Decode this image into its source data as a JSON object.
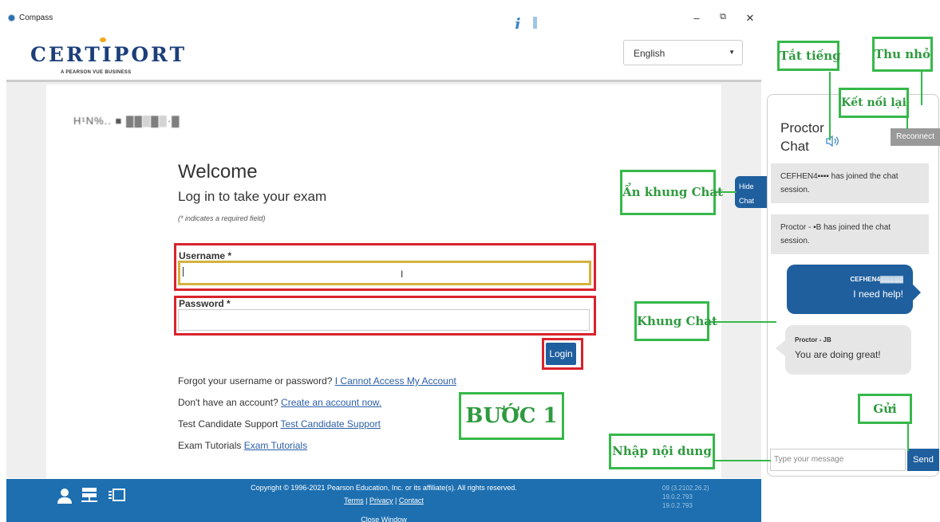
{
  "window": {
    "title": "Compass",
    "info_glyph": "i",
    "min": "–",
    "restore": "⧉",
    "close": "✕"
  },
  "brand": {
    "logo": "CERTIPORT",
    "logo_sub": "A PEARSON VUE BUSINESS",
    "accent": "#1c3f7a"
  },
  "language": {
    "selected": "English"
  },
  "login": {
    "candidate_id": "H¹N%.. ■ ▓▓▒▓▒·▓",
    "welcome": "Welcome",
    "subtitle": "Log in to take your exam",
    "required_note": "(* indicates a required field)",
    "username_label": "Username *",
    "username_value": "",
    "password_label": "Password *",
    "password_value": "",
    "login_button": "Login",
    "links": [
      {
        "text": "Forgot your username or password? ",
        "link": "I Cannot Access My Account"
      },
      {
        "text": "Don't have an account? ",
        "link": "Create an account now."
      },
      {
        "text": "Test Candidate Support ",
        "link": "Test Candidate Support"
      },
      {
        "text": "Exam Tutorials ",
        "link": "Exam Tutorials"
      }
    ]
  },
  "footer": {
    "copyright": "Copyright © 1996-2021 Pearson Education, Inc. or its affiliate(s). All rights reserved.",
    "terms": "Terms",
    "privacy": "Privacy",
    "contact": "Contact",
    "sep": " | ",
    "close_window": "Close Window",
    "versions": [
      "09 (3.2102.26.2)",
      "19.0.2.793",
      "19.0.2.793"
    ]
  },
  "chat": {
    "title_line1": "Proctor",
    "title_line2": "Chat",
    "reconnect": "Reconnect",
    "hide_line1": "Hide",
    "hide_line2": "Chat",
    "system_messages": [
      "CEFHEN4▪▪▪▪ has joined the chat session.",
      "Proctor - ▪B has joined the chat session."
    ],
    "my_name": "CEFHEN4▓▓▓▓▓",
    "my_message": "I need help!",
    "proctor_name": "Proctor - JB",
    "proctor_message": "You are doing great!",
    "input_placeholder": "Type your message",
    "send": "Send"
  },
  "annotations": {
    "mute": "Tắt tiếng",
    "minimize": "Thu nhỏ",
    "reconnect": "Kết nối lại",
    "hide_chat": "Ẩn khung Chat",
    "chat_frame": "Khung Chat",
    "send": "Gửi",
    "type_content": "Nhập nội dung",
    "step": "BƯỚC 1",
    "colors": {
      "green": "#36b84a",
      "red": "#d9232d",
      "blue": "#1f5f9e"
    }
  }
}
